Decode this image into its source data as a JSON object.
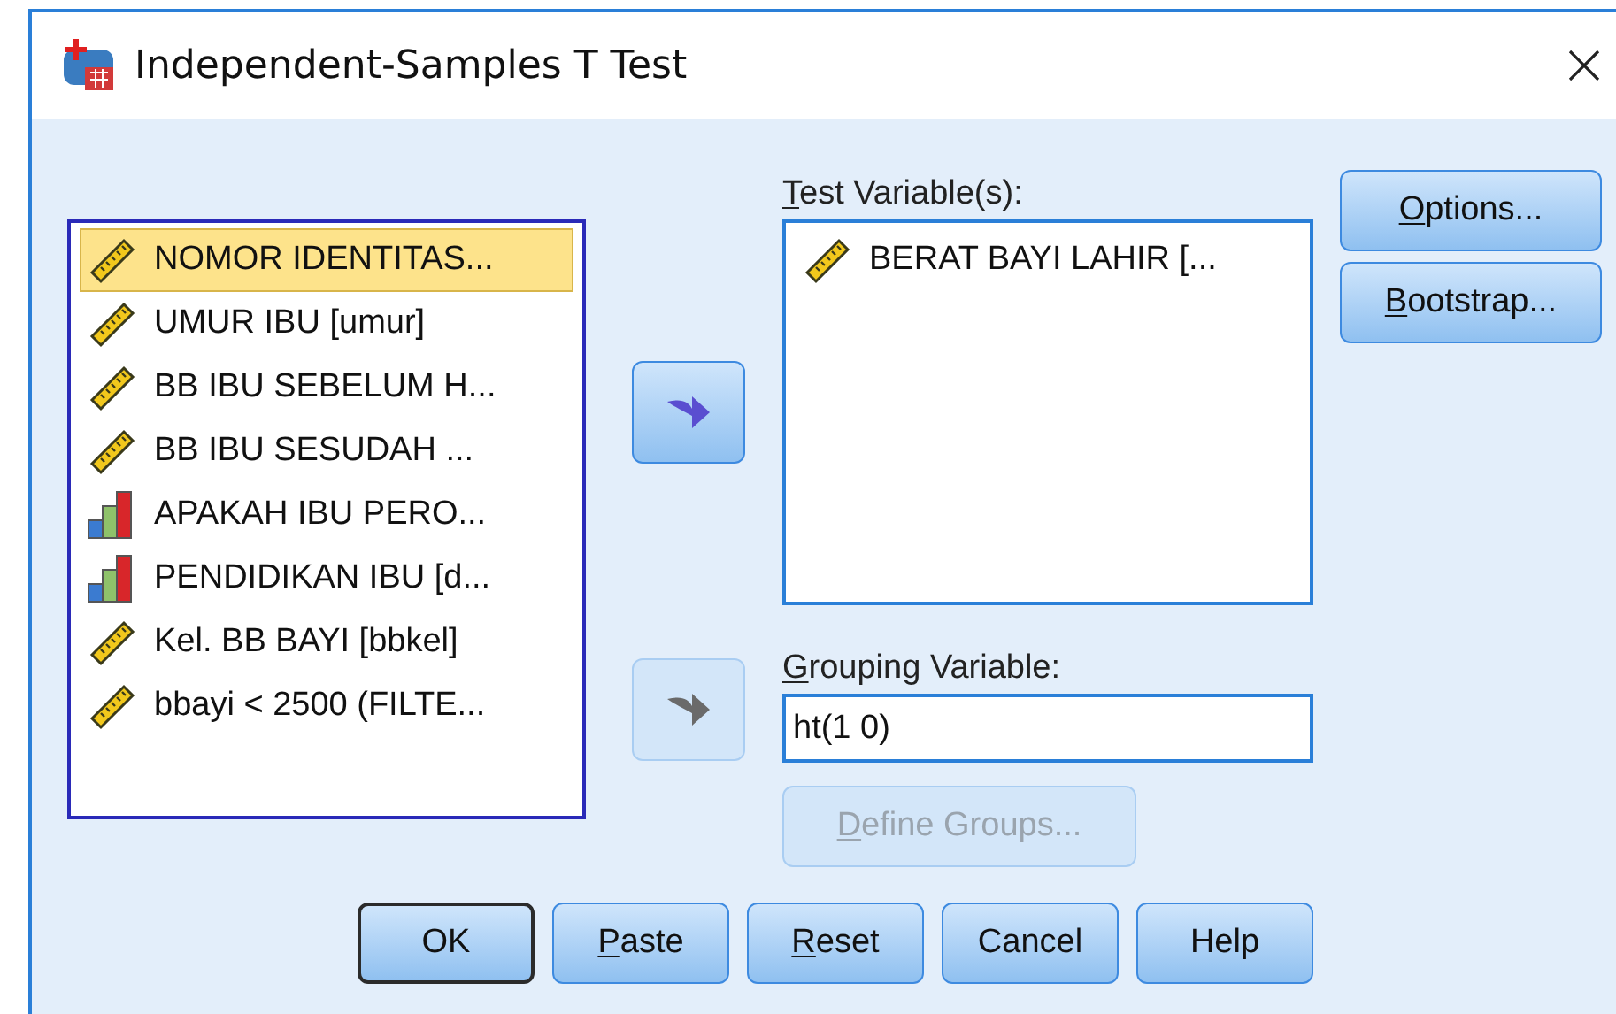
{
  "window": {
    "title": "Independent-Samples T Test"
  },
  "source_list": {
    "items": [
      {
        "label": "NOMOR IDENTITAS...",
        "kind": "scale",
        "selected": true
      },
      {
        "label": "UMUR IBU [umur]",
        "kind": "scale",
        "selected": false
      },
      {
        "label": "BB IBU SEBELUM H...",
        "kind": "scale",
        "selected": false
      },
      {
        "label": "BB IBU SESUDAH ...",
        "kind": "scale",
        "selected": false
      },
      {
        "label": "APAKAH IBU PERO...",
        "kind": "ordinal",
        "selected": false
      },
      {
        "label": "PENDIDIKAN IBU [d...",
        "kind": "ordinal",
        "selected": false
      },
      {
        "label": "Kel. BB BAYI [bbkel]",
        "kind": "scale",
        "selected": false
      },
      {
        "label": "bbayi < 2500 (FILTE...",
        "kind": "scale",
        "selected": false
      }
    ]
  },
  "move_buttons": [
    {
      "disabled": false
    },
    {
      "disabled": true
    }
  ],
  "test_variables": {
    "label": "Test Variable(s):",
    "mnemonic": true,
    "items": [
      {
        "label": "BERAT BAYI LAHIR [...",
        "kind": "scale",
        "selected": false
      }
    ]
  },
  "grouping_variable": {
    "label": "Grouping Variable:",
    "mnemonic": true,
    "value": "ht(1 0)"
  },
  "define_groups_button": {
    "label": "Define Groups...",
    "mnemonic": true,
    "disabled": true
  },
  "side_buttons": [
    {
      "label": "Options...",
      "mnemonic": true
    },
    {
      "label": "Bootstrap...",
      "mnemonic": true
    }
  ],
  "footer_buttons": [
    {
      "label": "OK",
      "mnemonic": false,
      "default": true
    },
    {
      "label": "Paste",
      "mnemonic": true,
      "default": false
    },
    {
      "label": "Reset",
      "mnemonic": true,
      "default": false
    },
    {
      "label": "Cancel",
      "mnemonic": false,
      "default": false
    },
    {
      "label": "Help",
      "mnemonic": false,
      "default": false
    }
  ]
}
